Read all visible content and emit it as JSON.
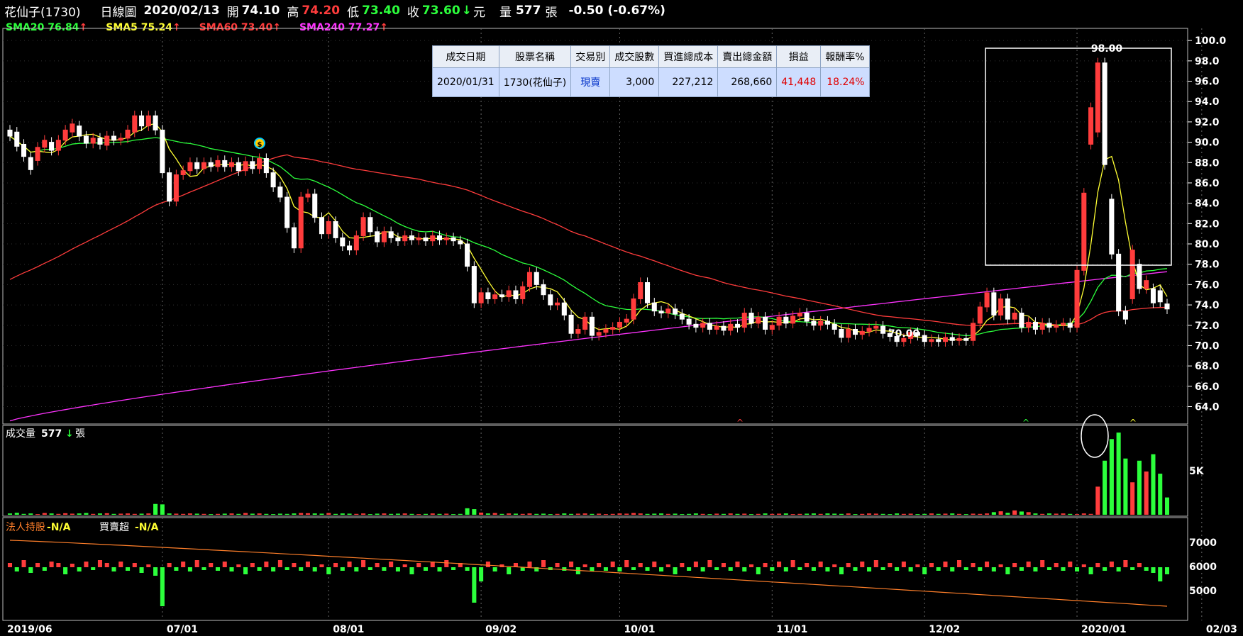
{
  "header": {
    "stock": "花仙子(1730)",
    "chart_type": "日線圖",
    "date": "2020/02/13",
    "open_label": "開",
    "open": "74.10",
    "high_label": "高",
    "high": "74.20",
    "low_label": "低",
    "low": "73.40",
    "close_label": "收",
    "close": "73.60",
    "close_arrow": "↓",
    "unit": "元",
    "volume_label": "量",
    "volume": "577",
    "volume_unit": "張",
    "change": "-0.50 (-0.67%)"
  },
  "sma": [
    {
      "label": "SMA20 76.84",
      "arrow": "↑",
      "color": "#2cff3c"
    },
    {
      "label": "SMA5 75.24",
      "arrow": "↑",
      "color": "#ffff33"
    },
    {
      "label": "SMA60 73.40",
      "arrow": "↑",
      "color": "#ff3c3c"
    },
    {
      "label": "SMA240 77.27",
      "arrow": "↑",
      "color": "#ff33ff"
    }
  ],
  "trade_table": {
    "headers": [
      "成交日期",
      "股票名稱",
      "交易別",
      "成交股數",
      "買進總成本",
      "賣出總金額",
      "損益",
      "報酬率%"
    ],
    "row": [
      "2020/01/31",
      "1730(花仙子)",
      "現賣",
      "3,000",
      "227,212",
      "268,660",
      "41,448",
      "18.24%"
    ]
  },
  "volume_panel": {
    "label": "成交量",
    "value": "577",
    "arrow": "↓",
    "unit": "張"
  },
  "inst_panel": {
    "label1": "法人持股",
    "value1": "-N/A",
    "label2": "買賣超",
    "value2": "-N/A"
  },
  "colors": {
    "up": "#ff3c3c",
    "down": "#2cff3c",
    "grid": "#666666",
    "axis_text": "#ffffff",
    "sma20": "#2cff3c",
    "sma5": "#ffff33",
    "sma60": "#ff3c3c",
    "sma240": "#ff33ff",
    "inst_line": "#ff7f2a"
  },
  "annotations": {
    "high_label": "98.00",
    "low_label": "70.00",
    "buy_marker": "$",
    "triangle_marker": "^"
  },
  "chart_data": [
    {
      "type": "candlestick",
      "title": "",
      "x_ticks": [
        "2019/06",
        "07/01",
        "08/01",
        "09/02",
        "10/01",
        "11/01",
        "12/02",
        "2020/01",
        "02/03"
      ],
      "y_ticks": [
        "64.0",
        "66.0",
        "68.0",
        "70.0",
        "72.0",
        "74.0",
        "76.0",
        "78.0",
        "80.0",
        "82.0",
        "84.0",
        "86.0",
        "88.0",
        "90.0",
        "92.0",
        "94.0",
        "96.0",
        "98.0",
        "100.0"
      ],
      "ylim": [
        62.5,
        100.5
      ],
      "grid": true,
      "candles": [
        {
          "o": 91.2,
          "c": 90.6
        },
        {
          "o": 91.0,
          "c": 89.6
        },
        {
          "o": 89.8,
          "c": 88.6
        },
        {
          "o": 88.5,
          "c": 87.3
        },
        {
          "o": 88.2,
          "c": 89.5
        },
        {
          "o": 89.5,
          "c": 90.2
        },
        {
          "o": 90.0,
          "c": 89.2
        },
        {
          "o": 89.2,
          "c": 90.2
        },
        {
          "o": 90.2,
          "c": 91.2
        },
        {
          "o": 91.0,
          "c": 91.8
        },
        {
          "o": 91.6,
          "c": 90.6
        },
        {
          "o": 90.6,
          "c": 89.9
        },
        {
          "o": 89.9,
          "c": 90.4
        },
        {
          "o": 90.4,
          "c": 89.8
        },
        {
          "o": 89.7,
          "c": 90.6
        },
        {
          "o": 90.6,
          "c": 90.2
        },
        {
          "o": 90.2,
          "c": 90.4
        },
        {
          "o": 90.4,
          "c": 91.2
        },
        {
          "o": 91.0,
          "c": 92.6
        },
        {
          "o": 92.6,
          "c": 91.6
        },
        {
          "o": 91.6,
          "c": 92.6
        },
        {
          "o": 92.6,
          "c": 91.2
        },
        {
          "o": 91.2,
          "c": 87.0
        },
        {
          "o": 87.0,
          "c": 84.2
        },
        {
          "o": 84.2,
          "c": 86.8
        },
        {
          "o": 86.8,
          "c": 87.2
        },
        {
          "o": 87.2,
          "c": 88.0
        },
        {
          "o": 88.0,
          "c": 87.4
        },
        {
          "o": 87.4,
          "c": 88.0
        },
        {
          "o": 88.0,
          "c": 87.6
        },
        {
          "o": 87.6,
          "c": 88.2
        },
        {
          "o": 88.2,
          "c": 87.6
        },
        {
          "o": 87.6,
          "c": 88.0
        },
        {
          "o": 88.0,
          "c": 87.2
        },
        {
          "o": 87.2,
          "c": 88.1
        },
        {
          "o": 88.1,
          "c": 87.4
        },
        {
          "o": 87.4,
          "c": 88.4
        },
        {
          "o": 88.4,
          "c": 87.0
        },
        {
          "o": 87.0,
          "c": 85.6
        },
        {
          "o": 85.6,
          "c": 84.6
        },
        {
          "o": 84.6,
          "c": 81.6
        },
        {
          "o": 81.6,
          "c": 79.6
        },
        {
          "o": 79.6,
          "c": 84.6
        },
        {
          "o": 84.6,
          "c": 84.9
        },
        {
          "o": 84.9,
          "c": 82.6
        },
        {
          "o": 82.6,
          "c": 81.0
        },
        {
          "o": 81.0,
          "c": 82.2
        },
        {
          "o": 82.2,
          "c": 80.6
        },
        {
          "o": 80.6,
          "c": 79.8
        },
        {
          "o": 79.8,
          "c": 79.4
        },
        {
          "o": 79.4,
          "c": 80.8
        },
        {
          "o": 80.8,
          "c": 82.6
        },
        {
          "o": 82.6,
          "c": 81.2
        },
        {
          "o": 81.2,
          "c": 80.2
        },
        {
          "o": 80.2,
          "c": 81.2
        },
        {
          "o": 81.2,
          "c": 80.6
        },
        {
          "o": 80.6,
          "c": 80.3
        },
        {
          "o": 80.3,
          "c": 80.8
        },
        {
          "o": 80.8,
          "c": 80.4
        },
        {
          "o": 80.4,
          "c": 80.6
        },
        {
          "o": 80.6,
          "c": 80.3
        },
        {
          "o": 80.3,
          "c": 80.8
        },
        {
          "o": 80.8,
          "c": 80.4
        },
        {
          "o": 80.4,
          "c": 80.6
        },
        {
          "o": 80.6,
          "c": 80.3
        },
        {
          "o": 80.3,
          "c": 80.0
        },
        {
          "o": 80.0,
          "c": 77.8
        },
        {
          "o": 77.8,
          "c": 74.2
        },
        {
          "o": 74.2,
          "c": 75.2
        },
        {
          "o": 75.2,
          "c": 74.6
        },
        {
          "o": 74.6,
          "c": 75.0
        },
        {
          "o": 75.0,
          "c": 74.8
        },
        {
          "o": 74.8,
          "c": 75.4
        },
        {
          "o": 75.4,
          "c": 74.6
        },
        {
          "o": 74.6,
          "c": 75.8
        },
        {
          "o": 75.8,
          "c": 77.2
        },
        {
          "o": 77.2,
          "c": 76.0
        },
        {
          "o": 76.0,
          "c": 75.0
        },
        {
          "o": 75.0,
          "c": 74.0
        },
        {
          "o": 74.0,
          "c": 74.2
        },
        {
          "o": 74.2,
          "c": 73.0
        },
        {
          "o": 73.0,
          "c": 71.2
        },
        {
          "o": 71.2,
          "c": 71.6
        },
        {
          "o": 71.6,
          "c": 72.8
        },
        {
          "o": 72.8,
          "c": 71.0
        },
        {
          "o": 71.0,
          "c": 71.3
        },
        {
          "o": 71.3,
          "c": 71.6
        },
        {
          "o": 71.6,
          "c": 71.8
        },
        {
          "o": 71.8,
          "c": 72.3
        },
        {
          "o": 72.3,
          "c": 72.6
        },
        {
          "o": 72.6,
          "c": 74.6
        },
        {
          "o": 74.6,
          "c": 76.2
        },
        {
          "o": 76.2,
          "c": 74.2
        },
        {
          "o": 74.2,
          "c": 73.4
        },
        {
          "o": 73.4,
          "c": 73.2
        },
        {
          "o": 73.2,
          "c": 73.6
        },
        {
          "o": 73.6,
          "c": 73.1
        },
        {
          "o": 73.1,
          "c": 72.6
        },
        {
          "o": 72.6,
          "c": 72.1
        },
        {
          "o": 72.1,
          "c": 71.8
        },
        {
          "o": 71.8,
          "c": 72.2
        },
        {
          "o": 72.2,
          "c": 71.6
        },
        {
          "o": 71.6,
          "c": 71.9
        },
        {
          "o": 71.9,
          "c": 71.5
        },
        {
          "o": 71.5,
          "c": 72.1
        },
        {
          "o": 72.1,
          "c": 71.8
        },
        {
          "o": 71.8,
          "c": 73.2
        },
        {
          "o": 73.2,
          "c": 72.2
        },
        {
          "o": 72.2,
          "c": 72.8
        },
        {
          "o": 72.8,
          "c": 71.6
        },
        {
          "o": 71.6,
          "c": 72.0
        },
        {
          "o": 72.0,
          "c": 72.8
        },
        {
          "o": 72.8,
          "c": 72.2
        },
        {
          "o": 72.2,
          "c": 72.9
        },
        {
          "o": 72.9,
          "c": 73.2
        },
        {
          "o": 73.2,
          "c": 72.4
        },
        {
          "o": 72.4,
          "c": 72.0
        },
        {
          "o": 72.0,
          "c": 72.4
        },
        {
          "o": 72.4,
          "c": 72.1
        },
        {
          "o": 72.1,
          "c": 71.6
        },
        {
          "o": 71.6,
          "c": 70.8
        },
        {
          "o": 70.8,
          "c": 71.6
        },
        {
          "o": 71.6,
          "c": 71.1
        },
        {
          "o": 71.1,
          "c": 71.4
        },
        {
          "o": 71.4,
          "c": 71.7
        },
        {
          "o": 71.7,
          "c": 71.9
        },
        {
          "o": 71.9,
          "c": 71.2
        },
        {
          "o": 71.2,
          "c": 70.9
        },
        {
          "o": 70.9,
          "c": 70.4
        },
        {
          "o": 70.4,
          "c": 70.7
        },
        {
          "o": 70.7,
          "c": 71.3
        },
        {
          "o": 71.3,
          "c": 71.0
        },
        {
          "o": 71.0,
          "c": 70.4
        },
        {
          "o": 70.4,
          "c": 70.6
        },
        {
          "o": 70.6,
          "c": 70.4
        },
        {
          "o": 70.4,
          "c": 70.8
        },
        {
          "o": 70.8,
          "c": 70.5
        },
        {
          "o": 70.5,
          "c": 70.7
        },
        {
          "o": 70.7,
          "c": 70.5
        },
        {
          "o": 70.5,
          "c": 72.2
        },
        {
          "o": 72.2,
          "c": 73.8
        },
        {
          "o": 73.8,
          "c": 75.2
        },
        {
          "o": 75.2,
          "c": 73.0
        },
        {
          "o": 73.0,
          "c": 74.6
        },
        {
          "o": 74.6,
          "c": 72.6
        },
        {
          "o": 72.6,
          "c": 73.2
        },
        {
          "o": 73.2,
          "c": 71.8
        },
        {
          "o": 71.8,
          "c": 72.3
        },
        {
          "o": 72.3,
          "c": 71.6
        },
        {
          "o": 71.6,
          "c": 72.2
        },
        {
          "o": 72.2,
          "c": 71.8
        },
        {
          "o": 71.8,
          "c": 72.0
        },
        {
          "o": 72.0,
          "c": 72.2
        },
        {
          "o": 72.2,
          "c": 71.8
        },
        {
          "o": 71.8,
          "c": 77.4
        },
        {
          "o": 77.4,
          "c": 85.0
        },
        {
          "o": 89.8,
          "c": 93.4
        },
        {
          "o": 91.0,
          "c": 97.8
        },
        {
          "o": 97.8,
          "c": 87.8
        },
        {
          "o": 84.4,
          "c": 79.0
        },
        {
          "o": 79.0,
          "c": 73.4
        },
        {
          "o": 73.4,
          "c": 72.6
        },
        {
          "o": 74.6,
          "c": 79.4
        },
        {
          "o": 78.0,
          "c": 75.6
        },
        {
          "o": 75.6,
          "c": 76.4
        },
        {
          "o": 75.6,
          "c": 74.2
        },
        {
          "o": 75.4,
          "c": 74.3
        },
        {
          "o": 74.1,
          "c": 73.6
        }
      ],
      "high": 98.0,
      "low": 70.0
    },
    {
      "type": "bar",
      "title": "成交量",
      "y_ticks": [
        "5K"
      ],
      "values": [
        60,
        90,
        40,
        60,
        30,
        80,
        60,
        40,
        70,
        50,
        60,
        80,
        40,
        60,
        70,
        40,
        50,
        60,
        40,
        50,
        60,
        500,
        480,
        60,
        50,
        40,
        60,
        50,
        40,
        30,
        40,
        50,
        60,
        40,
        80,
        50,
        60,
        40,
        30,
        50,
        40,
        60,
        80,
        70,
        60,
        50,
        80,
        40,
        60,
        50,
        40,
        60,
        30,
        50,
        60,
        40,
        50,
        60,
        40,
        30,
        40,
        60,
        40,
        50,
        30,
        40,
        300,
        260,
        100,
        60,
        80,
        40,
        60,
        50,
        40,
        60,
        40,
        50,
        30,
        40,
        60,
        40,
        50,
        60,
        40,
        50,
        30,
        40,
        60,
        50,
        80,
        60,
        40,
        50,
        60,
        40,
        50,
        30,
        40,
        60,
        40,
        30,
        50,
        40,
        60,
        40,
        50,
        30,
        40,
        60,
        40,
        50,
        60,
        30,
        40,
        50,
        60,
        40,
        60,
        50,
        40,
        60,
        30,
        40,
        60,
        50,
        40,
        30,
        60,
        40,
        50,
        30,
        40,
        60,
        40,
        50,
        60,
        40,
        30,
        50,
        40,
        60,
        120,
        160,
        90,
        200,
        150,
        120,
        60,
        40,
        60,
        50,
        60,
        40,
        30,
        60,
        40,
        1300,
        2500,
        3500,
        3800,
        2600,
        1500,
        2500,
        2000,
        2800,
        1900,
        800,
        400,
        200
      ]
    },
    {
      "type": "bar",
      "title": "法人持股 / 買賣超",
      "y_ticks": [
        "7000",
        "6000",
        "5000"
      ]
    }
  ]
}
